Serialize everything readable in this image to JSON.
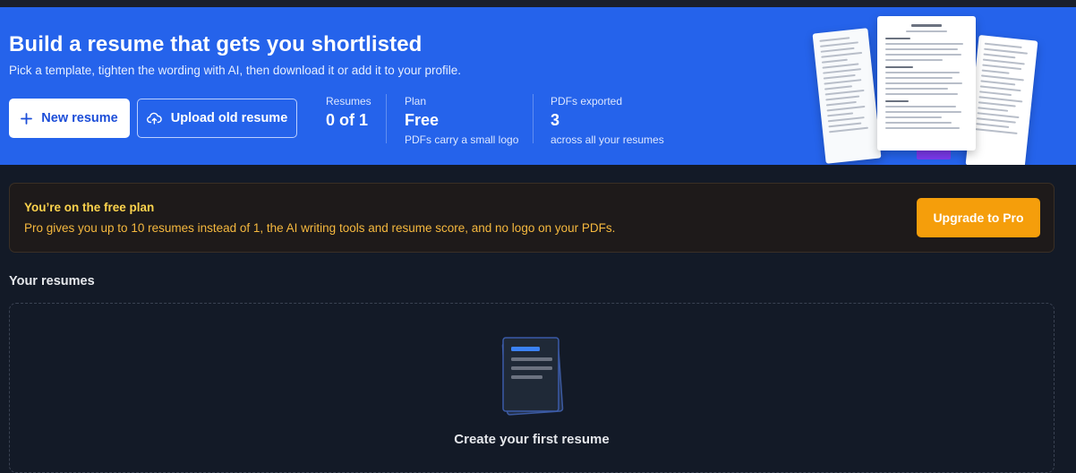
{
  "hero": {
    "title": "Build a resume that gets you shortlisted",
    "subtitle": "Pick a template, tighten the wording with AI, then download it or add it to your profile.",
    "new_resume_label": "New resume",
    "upload_label": "Upload old resume",
    "new_resume_icon": "plus-icon",
    "upload_icon": "cloud-upload-icon"
  },
  "stats": [
    {
      "label": "Resumes",
      "value": "0 of 1",
      "note": ""
    },
    {
      "label": "Plan",
      "value": "Free",
      "note": "PDFs carry a small logo"
    },
    {
      "label": "PDFs exported",
      "value": "3",
      "note": "across all your resumes"
    }
  ],
  "promo": {
    "title": "You’re on the free plan",
    "text": "Pro gives you up to 10 resumes instead of 1, the AI writing tools and resume score, and no logo on your PDFs.",
    "button_label": "Upgrade to Pro"
  },
  "resumes": {
    "section_title": "Your resumes",
    "empty_title": "Create your first resume",
    "empty_icon": "document-stack-icon"
  },
  "colors": {
    "hero_bg": "#2563eb",
    "page_bg": "#131a27",
    "promo_accent": "#f59e0b",
    "promo_title": "#fcd34d"
  }
}
